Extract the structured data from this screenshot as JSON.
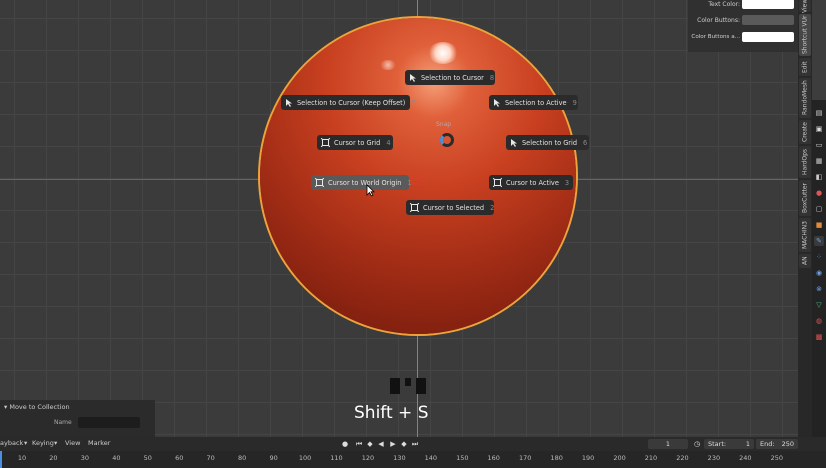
{
  "pie_menu": {
    "title": "Snap",
    "items": [
      {
        "label": "Selection to Cursor",
        "key": "8",
        "icon": "arrow-cursor-icon"
      },
      {
        "label": "Selection to Cursor (Keep Offset)",
        "key": "7",
        "icon": "arrow-cursor-icon"
      },
      {
        "label": "Selection to Active",
        "key": "9",
        "icon": "arrow-cursor-icon"
      },
      {
        "label": "Cursor to Grid",
        "key": "4",
        "icon": "cursor-snap-icon"
      },
      {
        "label": "Selection to Grid",
        "key": "6",
        "icon": "arrow-cursor-icon"
      },
      {
        "label": "Cursor to World Origin",
        "key": "1",
        "icon": "cursor-snap-icon"
      },
      {
        "label": "Cursor to Active",
        "key": "3",
        "icon": "cursor-snap-icon"
      },
      {
        "label": "Cursor to Selected",
        "key": "2",
        "icon": "cursor-snap-icon"
      }
    ]
  },
  "npanel": {
    "text_color_label": "Text Color:",
    "color_buttons_label": "Color Buttons:",
    "color_buttons_a_label": "Color Buttons a...",
    "text_color": "#ffffff",
    "color_buttons": "#5a5a5a",
    "color_buttons_a": "#ffffff"
  },
  "side_tabs": [
    "View",
    "Shortcut VUr",
    "Edit",
    "RandoMesh",
    "Create",
    "HardOps",
    "BoxCutter",
    "MACHIN3",
    "AN"
  ],
  "keystroke": {
    "text": "Shift + S"
  },
  "move_to_collection": {
    "title": "Move to Collection",
    "name_label": "Name"
  },
  "timeline": {
    "menu": [
      "ayback",
      "Keying",
      "View",
      "Marker"
    ],
    "current_frame": "1",
    "start_label": "Start:",
    "start": "1",
    "end_label": "End:",
    "end": "250",
    "ticks": [
      "10",
      "20",
      "30",
      "40",
      "50",
      "60",
      "70",
      "80",
      "90",
      "100",
      "110",
      "120",
      "130",
      "140",
      "150",
      "160",
      "170",
      "180",
      "190",
      "200",
      "210",
      "220",
      "230",
      "240",
      "250"
    ]
  },
  "colors": {
    "selection_outline": "#f0a23a",
    "sphere": "#c84020",
    "accent": "#4a8fe0"
  }
}
